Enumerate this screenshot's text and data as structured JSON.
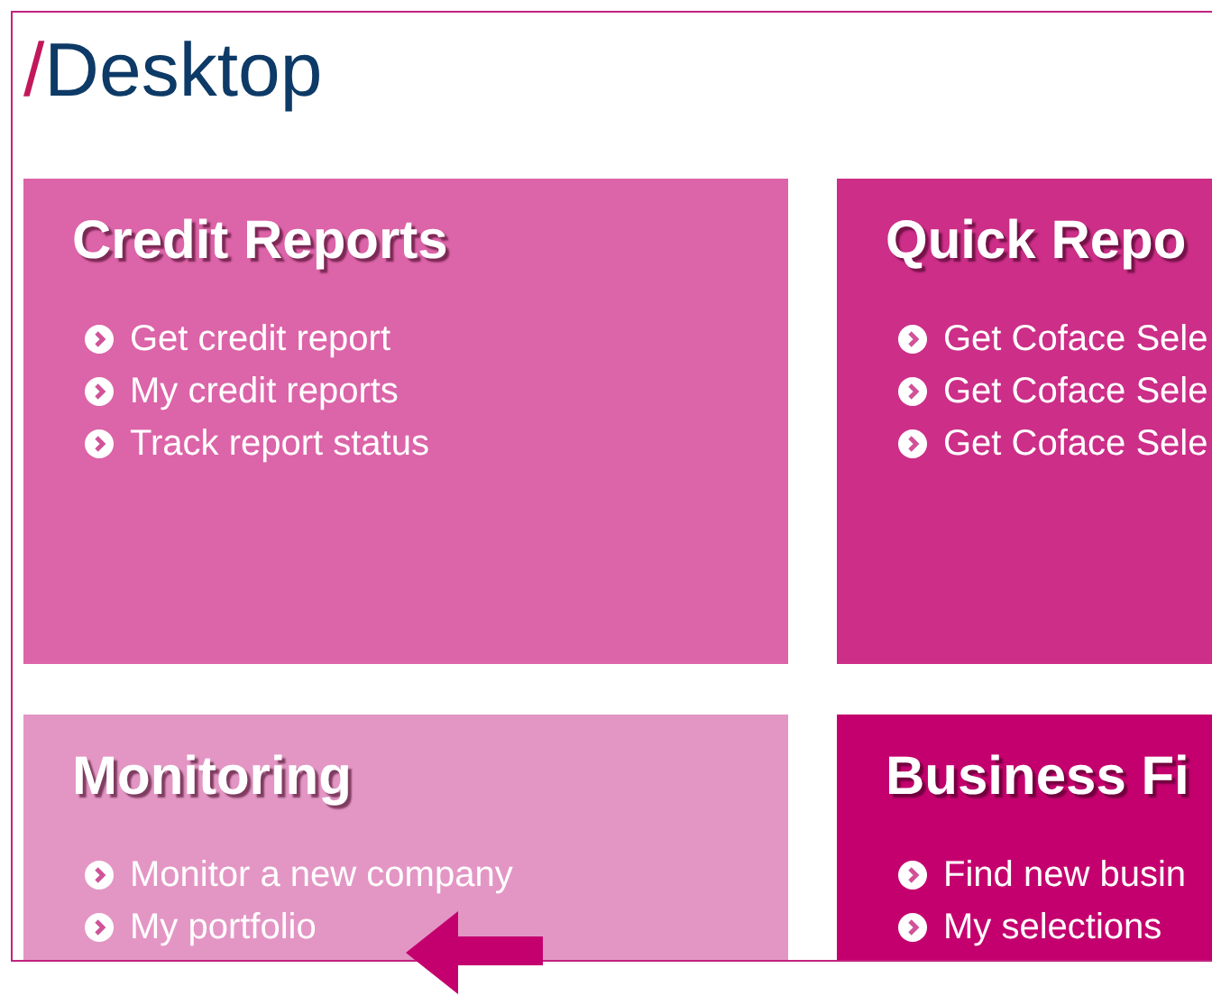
{
  "header": {
    "separator": "/",
    "title": "Desktop"
  },
  "tiles": [
    {
      "title": "Credit Reports",
      "color": "#dc64a8",
      "links": [
        "Get credit report",
        "My credit reports",
        "Track report status"
      ]
    },
    {
      "title": "Quick Repo",
      "color": "#cc2e88",
      "links": [
        "Get Coface Sele",
        "Get Coface Sele",
        "Get Coface Sele"
      ]
    },
    {
      "title": "Monitoring",
      "color": "#e396c4",
      "links": [
        "Monitor a new company",
        "My portfolio"
      ]
    },
    {
      "title": "Business Fi",
      "color": "#c4006e",
      "links": [
        "Find new busin",
        "My selections"
      ]
    }
  ]
}
